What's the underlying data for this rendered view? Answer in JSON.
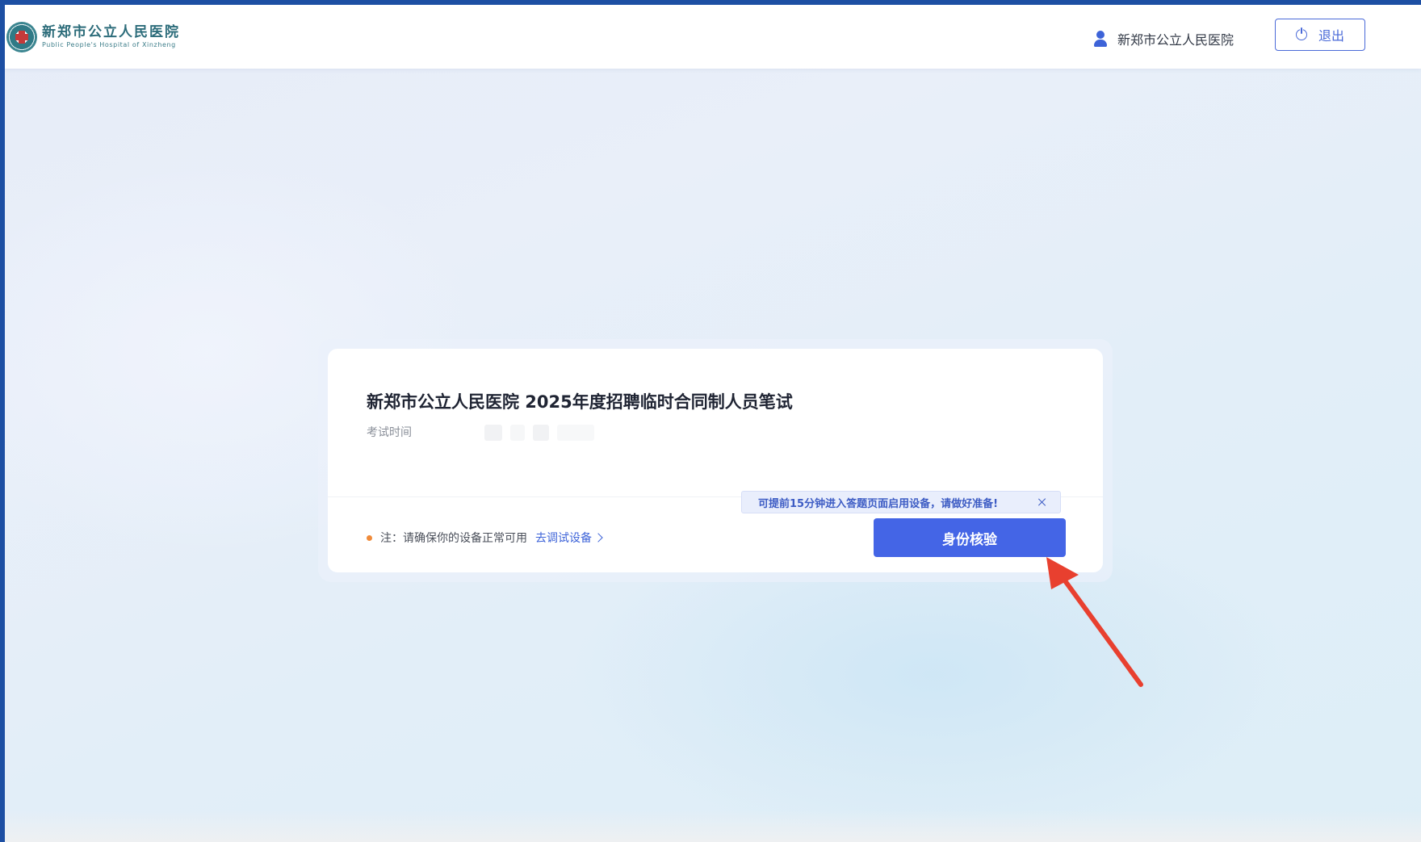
{
  "header": {
    "logo": {
      "name_cn": "新郑市公立人民医院",
      "name_en": "Public People's Hospital of Xinzheng"
    },
    "user_name": "新郑市公立人民医院",
    "logout_label": "退出"
  },
  "exam_card": {
    "title": "新郑市公立人民医院 2025年度招聘临时合同制人员笔试",
    "time_label": "考试时间",
    "time_value": "",
    "note_text": "注：请确保你的设备正常可用",
    "debug_link": "去调试设备",
    "tooltip_text": "可提前15分钟进入答题页面启用设备，请做好准备!",
    "verify_button": "身份核验"
  },
  "colors": {
    "frame": "#1d4fa3",
    "primary": "#4465e6",
    "link": "#3d63d8",
    "annotation_arrow": "#e8402f"
  },
  "icons": {
    "user": "user-icon",
    "power": "power-icon",
    "close": "close-icon",
    "chevron": "chevron-right-icon"
  }
}
